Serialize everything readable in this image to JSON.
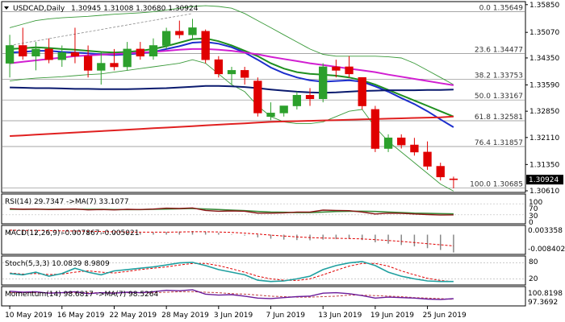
{
  "header": {
    "symbol": "USDCAD,Daily",
    "ohlc": "1.30945 1.31008 1.30680 1.30924"
  },
  "colors": {
    "bull": "#2ca02c",
    "bear": "#e00000",
    "ma_green": "#1f8f1f",
    "ma_blue": "#1c2ecc",
    "ma_magenta": "#d11fd1",
    "ma_red": "#e02020",
    "ma_navy": "#0a1a6e",
    "bb": "#3a9a3a",
    "fib": "#888888",
    "rsi_line": "#8a1414",
    "rsi_ma": "#3a8a3a",
    "macd_hist": "#888888",
    "macd_signal": "#e00000",
    "stoch_main": "#20a0a0",
    "stoch_signal": "#e00000",
    "mom_main": "#6a1b9a",
    "mom_ma": "#c04040",
    "current_price_bg": "#000000"
  },
  "chart_data": {
    "type": "candlestick",
    "title": "USDCAD,Daily",
    "ylim": [
      1.3061,
      1.3589
    ],
    "y_ticks": [
      "1.35850",
      "1.35070",
      "1.34350",
      "1.33590",
      "1.32850",
      "1.32110",
      "1.31350",
      "1.30924",
      "1.30610"
    ],
    "current_price": "1.30924",
    "x_ticks": [
      "10 May 2019",
      "16 May 2019",
      "22 May 2019",
      "28 May 2019",
      "3 Jun 2019",
      "7 Jun 2019",
      "13 Jun 2019",
      "19 Jun 2019",
      "25 Jun 2019"
    ],
    "x_tick_index": [
      0,
      4,
      8,
      12,
      16,
      20,
      24,
      28,
      32
    ],
    "candles": [
      {
        "o": 1.342,
        "h": 1.35,
        "l": 1.338,
        "c": 1.347
      },
      {
        "o": 1.347,
        "h": 1.352,
        "l": 1.343,
        "c": 1.344
      },
      {
        "o": 1.344,
        "h": 1.348,
        "l": 1.34,
        "c": 1.346
      },
      {
        "o": 1.346,
        "h": 1.349,
        "l": 1.342,
        "c": 1.343
      },
      {
        "o": 1.343,
        "h": 1.347,
        "l": 1.341,
        "c": 1.345
      },
      {
        "o": 1.345,
        "h": 1.352,
        "l": 1.342,
        "c": 1.344
      },
      {
        "o": 1.344,
        "h": 1.347,
        "l": 1.338,
        "c": 1.34
      },
      {
        "o": 1.34,
        "h": 1.345,
        "l": 1.336,
        "c": 1.342
      },
      {
        "o": 1.342,
        "h": 1.346,
        "l": 1.34,
        "c": 1.341
      },
      {
        "o": 1.341,
        "h": 1.348,
        "l": 1.34,
        "c": 1.346
      },
      {
        "o": 1.346,
        "h": 1.348,
        "l": 1.343,
        "c": 1.344
      },
      {
        "o": 1.344,
        "h": 1.349,
        "l": 1.343,
        "c": 1.347
      },
      {
        "o": 1.347,
        "h": 1.352,
        "l": 1.346,
        "c": 1.351
      },
      {
        "o": 1.351,
        "h": 1.354,
        "l": 1.349,
        "c": 1.35
      },
      {
        "o": 1.35,
        "h": 1.3545,
        "l": 1.349,
        "c": 1.352
      },
      {
        "o": 1.351,
        "h": 1.3515,
        "l": 1.342,
        "c": 1.343
      },
      {
        "o": 1.343,
        "h": 1.344,
        "l": 1.338,
        "c": 1.339
      },
      {
        "o": 1.339,
        "h": 1.341,
        "l": 1.336,
        "c": 1.34
      },
      {
        "o": 1.34,
        "h": 1.341,
        "l": 1.336,
        "c": 1.338
      },
      {
        "o": 1.337,
        "h": 1.338,
        "l": 1.327,
        "c": 1.328
      },
      {
        "o": 1.327,
        "h": 1.331,
        "l": 1.326,
        "c": 1.328
      },
      {
        "o": 1.328,
        "h": 1.33,
        "l": 1.327,
        "c": 1.33
      },
      {
        "o": 1.33,
        "h": 1.334,
        "l": 1.329,
        "c": 1.333
      },
      {
        "o": 1.333,
        "h": 1.335,
        "l": 1.33,
        "c": 1.332
      },
      {
        "o": 1.332,
        "h": 1.342,
        "l": 1.331,
        "c": 1.341
      },
      {
        "o": 1.341,
        "h": 1.343,
        "l": 1.338,
        "c": 1.34
      },
      {
        "o": 1.341,
        "h": 1.344,
        "l": 1.338,
        "c": 1.339
      },
      {
        "o": 1.338,
        "h": 1.338,
        "l": 1.329,
        "c": 1.33
      },
      {
        "o": 1.329,
        "h": 1.33,
        "l": 1.317,
        "c": 1.318
      },
      {
        "o": 1.318,
        "h": 1.322,
        "l": 1.317,
        "c": 1.321
      },
      {
        "o": 1.321,
        "h": 1.322,
        "l": 1.318,
        "c": 1.319
      },
      {
        "o": 1.319,
        "h": 1.321,
        "l": 1.316,
        "c": 1.317
      },
      {
        "o": 1.317,
        "h": 1.32,
        "l": 1.312,
        "c": 1.313
      },
      {
        "o": 1.313,
        "h": 1.314,
        "l": 1.309,
        "c": 1.31
      },
      {
        "o": 1.30945,
        "h": 1.31008,
        "l": 1.3068,
        "c": 1.30924
      }
    ],
    "moving_averages": [
      {
        "color": "ma_green",
        "values": [
          1.346,
          1.3462,
          1.3465,
          1.3463,
          1.346,
          1.3458,
          1.3455,
          1.3452,
          1.345,
          1.3452,
          1.3455,
          1.346,
          1.3468,
          1.3478,
          1.3488,
          1.349,
          1.3482,
          1.347,
          1.3455,
          1.344,
          1.342,
          1.3405,
          1.3395,
          1.339,
          1.3388,
          1.3385,
          1.338,
          1.3372,
          1.336,
          1.3345,
          1.333,
          1.3315,
          1.33,
          1.3285,
          1.327
        ]
      },
      {
        "color": "ma_blue",
        "values": [
          1.345,
          1.3452,
          1.3455,
          1.3455,
          1.3452,
          1.345,
          1.3448,
          1.3445,
          1.3443,
          1.3445,
          1.3448,
          1.3452,
          1.346,
          1.3468,
          1.3478,
          1.348,
          1.3475,
          1.3465,
          1.345,
          1.343,
          1.3408,
          1.3392,
          1.338,
          1.3372,
          1.3368,
          1.337,
          1.3372,
          1.3368,
          1.3355,
          1.334,
          1.3322,
          1.3305,
          1.3285,
          1.3262,
          1.324
        ]
      },
      {
        "color": "ma_magenta",
        "values": [
          1.342,
          1.3424,
          1.3428,
          1.3432,
          1.3436,
          1.344,
          1.3442,
          1.3444,
          1.3446,
          1.3448,
          1.345,
          1.3452,
          1.3455,
          1.3458,
          1.346,
          1.346,
          1.3458,
          1.3455,
          1.345,
          1.3445,
          1.3438,
          1.3432,
          1.3426,
          1.342,
          1.3415,
          1.341,
          1.3405,
          1.34,
          1.3395,
          1.3388,
          1.3382,
          1.3376,
          1.337,
          1.3364,
          1.3358
        ]
      },
      {
        "color": "ma_navy",
        "values": [
          1.3352,
          1.3351,
          1.335,
          1.335,
          1.3349,
          1.3348,
          1.3348,
          1.3347,
          1.3347,
          1.3347,
          1.3348,
          1.3349,
          1.335,
          1.3352,
          1.3354,
          1.3356,
          1.3356,
          1.3355,
          1.3353,
          1.335,
          1.3346,
          1.3343,
          1.334,
          1.3338,
          1.3337,
          1.3338,
          1.334,
          1.3342,
          1.3343,
          1.3344,
          1.3344,
          1.3344,
          1.3345,
          1.3345,
          1.3346
        ]
      },
      {
        "color": "ma_red",
        "values": [
          1.3215,
          1.3217,
          1.3219,
          1.3221,
          1.3223,
          1.3225,
          1.3227,
          1.3229,
          1.3231,
          1.3233,
          1.3235,
          1.3237,
          1.3239,
          1.3241,
          1.3243,
          1.3245,
          1.3247,
          1.3249,
          1.3251,
          1.3253,
          1.3255,
          1.3256,
          1.3257,
          1.3258,
          1.3259,
          1.326,
          1.3261,
          1.3262,
          1.3263,
          1.3264,
          1.3265,
          1.3266,
          1.3267,
          1.3268,
          1.327
        ]
      }
    ],
    "bollinger_upper": [
      1.352,
      1.353,
      1.354,
      1.3545,
      1.3548,
      1.355,
      1.3552,
      1.3555,
      1.3558,
      1.356,
      1.3562,
      1.3565,
      1.357,
      1.3575,
      1.358,
      1.3582,
      1.358,
      1.3575,
      1.356,
      1.354,
      1.352,
      1.35,
      1.348,
      1.346,
      1.3445,
      1.344,
      1.344,
      1.344,
      1.344,
      1.3438,
      1.3435,
      1.342,
      1.34,
      1.338,
      1.336
    ],
    "bollinger_lower": [
      1.337,
      1.3375,
      1.3378,
      1.338,
      1.3382,
      1.3385,
      1.3388,
      1.339,
      1.3395,
      1.34,
      1.3405,
      1.341,
      1.3415,
      1.342,
      1.343,
      1.342,
      1.339,
      1.336,
      1.334,
      1.33,
      1.327,
      1.3255,
      1.325,
      1.325,
      1.3255,
      1.327,
      1.3285,
      1.329,
      1.324,
      1.32,
      1.317,
      1.314,
      1.311,
      1.308,
      1.306
    ],
    "trendline": {
      "from": [
        0,
        1.347
      ],
      "to": [
        14,
        1.356
      ]
    },
    "fib_levels": [
      {
        "label": "0.0 1.35649",
        "value": 1.35649
      },
      {
        "label": "23.6 1.34477",
        "value": 1.34477
      },
      {
        "label": "38.2 1.33753",
        "value": 1.33753
      },
      {
        "label": "50.0 1.33167",
        "value": 1.33167
      },
      {
        "label": "61.8 1.32581",
        "value": 1.32581
      },
      {
        "label": "76.4 1.31857",
        "value": 1.31857
      },
      {
        "label": "100.0 1.30685",
        "value": 1.30685
      }
    ],
    "rsi": {
      "label": "RSI(14) 29.7347 ->MA(7) 33.1077",
      "levels": [
        "100",
        "70",
        "30",
        "0"
      ],
      "ylim": [
        0,
        100
      ],
      "main": [
        52,
        50,
        51,
        49,
        50,
        51,
        48,
        49,
        48,
        50,
        49,
        51,
        54,
        53,
        55,
        46,
        43,
        44,
        43,
        36,
        36,
        37,
        40,
        40,
        47,
        46,
        45,
        40,
        33,
        36,
        35,
        33,
        31,
        29,
        29.7
      ],
      "ma": [
        50,
        50,
        50,
        50,
        50,
        50,
        50,
        50,
        49,
        49,
        49,
        50,
        51,
        52,
        53,
        51,
        49,
        47,
        45,
        42,
        40,
        39,
        38,
        38,
        40,
        42,
        43,
        43,
        42,
        40,
        38,
        36,
        35,
        34,
        33.1
      ]
    },
    "macd": {
      "label": "MACD(12,26,9) -0.007867 -0.005021",
      "ticks": [
        "0.003358",
        "-0.008402"
      ],
      "ylim": [
        -0.0084,
        0.0034
      ],
      "hist": [
        0.0018,
        0.0017,
        0.0016,
        0.0015,
        0.0014,
        0.0013,
        0.0012,
        0.001,
        0.0009,
        0.0009,
        0.0009,
        0.001,
        0.0012,
        0.0014,
        0.0016,
        0.0013,
        0.0008,
        0.0002,
        -0.0004,
        -0.0012,
        -0.0018,
        -0.0022,
        -0.0024,
        -0.0025,
        -0.0022,
        -0.002,
        -0.0019,
        -0.0024,
        -0.0034,
        -0.004,
        -0.0046,
        -0.0052,
        -0.006,
        -0.0068,
        -0.0079
      ],
      "signal": [
        0.002,
        0.0019,
        0.0019,
        0.0018,
        0.0017,
        0.0016,
        0.0015,
        0.0014,
        0.0013,
        0.0012,
        0.0011,
        0.0011,
        0.0011,
        0.0012,
        0.0013,
        0.0013,
        0.0012,
        0.001,
        0.0007,
        0.0003,
        -0.0002,
        -0.0006,
        -0.001,
        -0.0013,
        -0.0015,
        -0.0016,
        -0.0017,
        -0.0019,
        -0.0022,
        -0.0026,
        -0.003,
        -0.0035,
        -0.004,
        -0.0045,
        -0.005
      ]
    },
    "stoch": {
      "label": "Stoch(5,3,3) 10.0839 8.9809",
      "levels": [
        "80",
        "20"
      ],
      "ylim": [
        0,
        100
      ],
      "main": [
        40,
        35,
        45,
        30,
        40,
        60,
        45,
        35,
        50,
        55,
        60,
        65,
        72,
        80,
        82,
        70,
        55,
        45,
        35,
        15,
        10,
        12,
        20,
        30,
        55,
        70,
        80,
        85,
        70,
        45,
        30,
        20,
        12,
        10,
        10.1
      ],
      "signal": [
        42,
        38,
        40,
        36,
        38,
        45,
        50,
        45,
        42,
        48,
        55,
        60,
        65,
        72,
        78,
        78,
        70,
        58,
        45,
        30,
        20,
        15,
        14,
        20,
        35,
        52,
        68,
        78,
        78,
        68,
        50,
        35,
        22,
        14,
        9.0
      ]
    },
    "momentum": {
      "label": "Momentum(14) 98.6817 ->MA(7) 98.5264",
      "ticks": [
        "100.8198",
        "97.3692"
      ],
      "ylim": [
        97.3692,
        100.8198
      ],
      "main": [
        100.2,
        100.0,
        100.1,
        99.8,
        99.9,
        100.1,
        99.7,
        99.9,
        99.8,
        100.0,
        99.9,
        100.1,
        100.4,
        100.3,
        100.5,
        99.6,
        99.4,
        99.5,
        99.2,
        98.8,
        98.7,
        98.9,
        99.1,
        99.2,
        99.8,
        99.9,
        99.7,
        99.3,
        98.8,
        99.0,
        98.9,
        98.8,
        98.6,
        98.5,
        98.68
      ],
      "ma": [
        99.9,
        99.9,
        99.9,
        99.9,
        99.9,
        99.9,
        99.9,
        99.9,
        99.9,
        99.9,
        99.9,
        99.9,
        100.0,
        100.1,
        100.1,
        100.0,
        99.9,
        99.7,
        99.6,
        99.4,
        99.2,
        99.1,
        99.0,
        99.0,
        99.1,
        99.2,
        99.4,
        99.4,
        99.3,
        99.2,
        99.1,
        98.9,
        98.8,
        98.7,
        98.53
      ]
    }
  }
}
